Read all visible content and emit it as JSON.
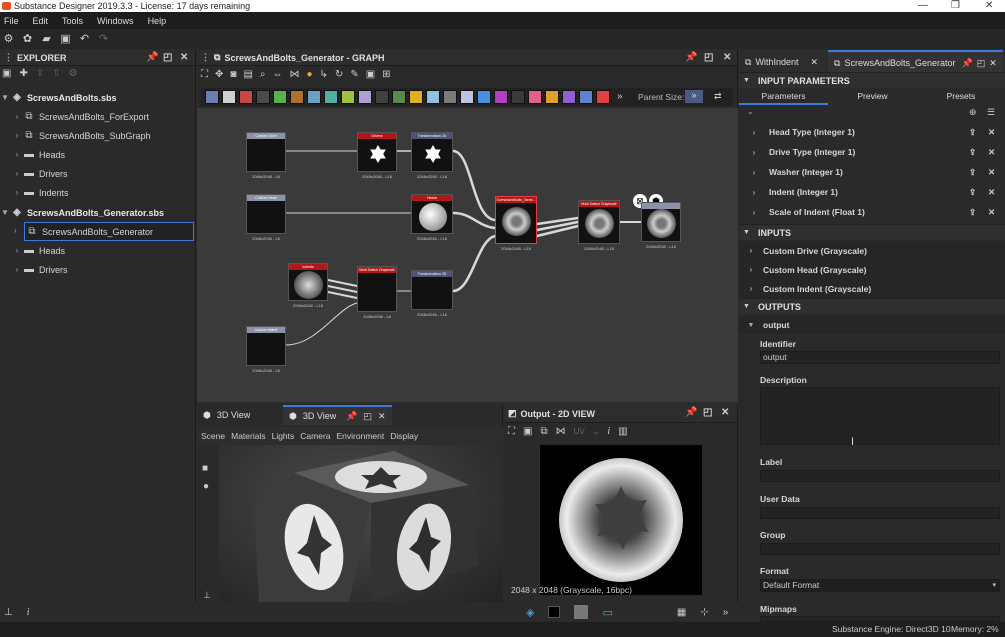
{
  "window": {
    "title": "Substance Designer 2019.3.3 - License: 17 days remaining"
  },
  "menu": [
    "File",
    "Edit",
    "Tools",
    "Windows",
    "Help"
  ],
  "explorer": {
    "title": "EXPLORER",
    "tree": [
      {
        "label": "ScrewsAndBolts.sbs",
        "level": 0,
        "bold": true
      },
      {
        "label": "ScrewsAndBolts_ForExport",
        "level": 1
      },
      {
        "label": "ScrewsAndBolts_SubGraph",
        "level": 1
      },
      {
        "label": "Heads",
        "level": 1
      },
      {
        "label": "Drivers",
        "level": 1
      },
      {
        "label": "Indents",
        "level": 1
      },
      {
        "label": "ScrewsAndBolts_Generator.sbs",
        "level": 0,
        "bold": true
      },
      {
        "label": "ScrewsAndBolts_Generator",
        "level": 1,
        "selected": true
      },
      {
        "label": "Heads",
        "level": 1
      },
      {
        "label": "Drivers",
        "level": 1
      }
    ]
  },
  "graph": {
    "title": "ScrewsAndBolts_Generator - GRAPH",
    "parent_size_label": "Parent Size:",
    "nodes": {
      "custom_drive": {
        "title": "Custom Drive",
        "res": "2048x2048 - L8"
      },
      "custom_head": {
        "title": "Custom Head",
        "res": "2048x2048 - L8"
      },
      "drivers": {
        "title": "Drivers",
        "res": "2048x2048 - L16"
      },
      "transform1": {
        "title": "Transformation 2D",
        "res": "2048x2048 - L16"
      },
      "heads": {
        "title": "Heads",
        "res": "2048x2048 - L16"
      },
      "indents": {
        "title": "Indents",
        "res": "2048x2048 - L16"
      },
      "multiswitch1": {
        "title": "Multi Switch Grayscale",
        "res": "2048x2048 - L8"
      },
      "transform2": {
        "title": "Transformation 2D",
        "res": "2048x2048 - L16"
      },
      "custom_indent": {
        "title": "Custom Indent",
        "res": "2048x2048 - L8"
      },
      "generator": {
        "title": "ScrewsAndBolts_Gene...",
        "res": "2048x2048 - L16"
      },
      "multiswitch2": {
        "title": "Multi Switch Grayscale",
        "res": "2048x2048 - L16"
      },
      "output": {
        "title": "",
        "res": "2048x2048 - L16"
      }
    }
  },
  "view3d": {
    "tabs": [
      "3D View",
      "3D View"
    ],
    "menu": [
      "Scene",
      "Materials",
      "Lights",
      "Camera",
      "Environment",
      "Display"
    ]
  },
  "view2d": {
    "title": "Output - 2D VIEW",
    "uv_label": "UV",
    "info": "2048 x 2048 (Grayscale, 16bpc)"
  },
  "right": {
    "tabs": [
      "WithIndent",
      "ScrewsAndBolts_Generator"
    ],
    "section_input_params": "INPUT PARAMETERS",
    "subtabs": [
      "Parameters",
      "Preview",
      "Presets"
    ],
    "params": [
      "Head Type (Integer 1)",
      "Drive Type (Integer 1)",
      "Washer (Integer 1)",
      "Indent (Integer 1)",
      "Scale of Indent (Float 1)"
    ],
    "section_inputs": "INPUTS",
    "inputs": [
      "Custom Drive (Grayscale)",
      "Custom Head (Grayscale)",
      "Custom Indent (Grayscale)"
    ],
    "section_outputs": "OUTPUTS",
    "output_name": "output",
    "fields": {
      "identifier_label": "Identifier",
      "identifier_value": "output",
      "description_label": "Description",
      "label_label": "Label",
      "userdata_label": "User Data",
      "group_label": "Group",
      "format_label": "Format",
      "format_value": "Default Format",
      "mipmaps_label": "Mipmaps"
    }
  },
  "status": {
    "engine": "Substance Engine: Direct3D 10",
    "memory": "Memory: 2%"
  },
  "colors": {
    "accent": "#3d7ad6",
    "node_red": "#b01818",
    "node_blue": "#4c5575",
    "node_gray": "#8c93a8"
  }
}
